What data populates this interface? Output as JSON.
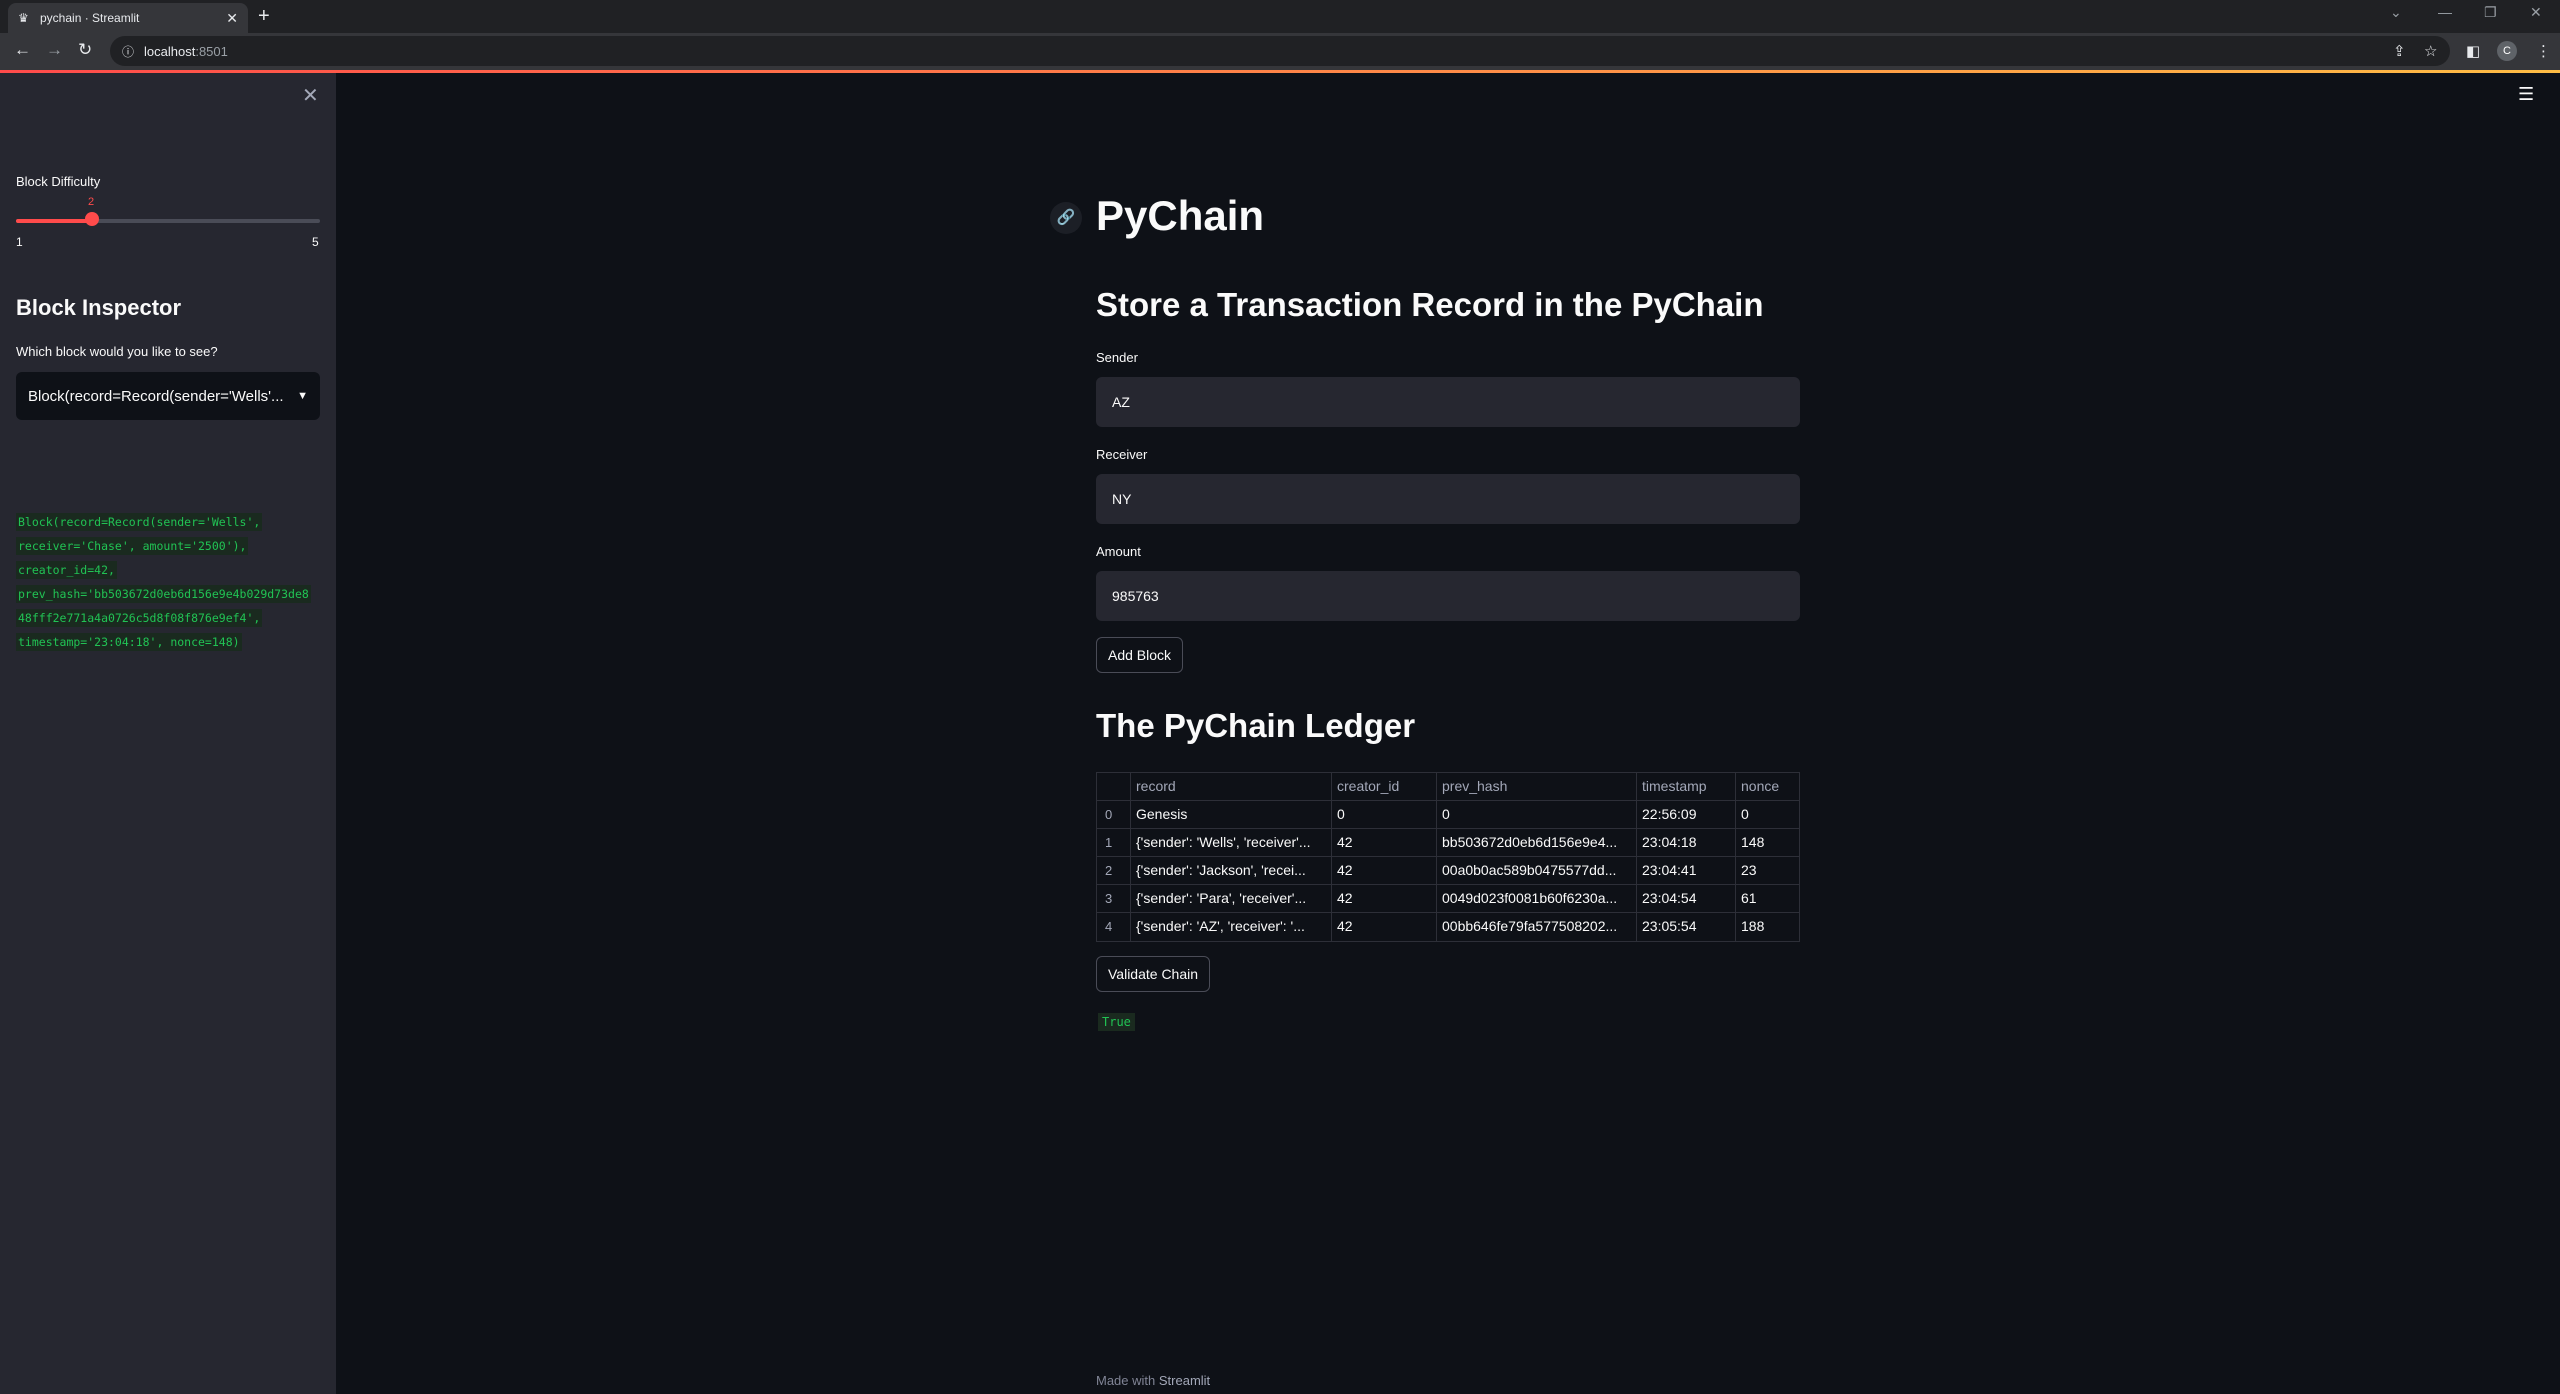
{
  "browser": {
    "tab_title": "pychain · Streamlit",
    "url_host": "localhost",
    "url_port": ":8501",
    "profile_initial": "C"
  },
  "sidebar": {
    "slider_label": "Block Difficulty",
    "slider_value": "2",
    "slider_min": "1",
    "slider_max": "5",
    "heading": "Block Inspector",
    "select_label": "Which block would you like to see?",
    "select_value": "Block(record=Record(sender='Wells'...",
    "block_detail_lines": [
      "Block(record=Record(sender='Wells',",
      "receiver='Chase', amount='2500'),",
      "creator_id=42,",
      "prev_hash='bb503672d0eb6d156e9e4b029d73de8",
      "48fff2e771a4a0726c5d8f08f876e9ef4',",
      "timestamp='23:04:18', nonce=148)"
    ]
  },
  "main": {
    "title": "PyChain",
    "form_heading": "Store a Transaction Record in the PyChain",
    "sender_label": "Sender",
    "sender_value": "AZ",
    "receiver_label": "Receiver",
    "receiver_value": "NY",
    "amount_label": "Amount",
    "amount_value": "985763",
    "add_block_label": "Add Block",
    "ledger_heading": "The PyChain Ledger",
    "validate_label": "Validate Chain",
    "validation_result": "True",
    "footer_prefix": "Made with",
    "footer_brand": "Streamlit"
  },
  "ledger": {
    "columns": [
      "",
      "record",
      "creator_id",
      "prev_hash",
      "timestamp",
      "nonce"
    ],
    "rows": [
      [
        "0",
        "Genesis",
        "0",
        "0",
        "22:56:09",
        "0"
      ],
      [
        "1",
        "{'sender': 'Wells', 'receiver'...",
        "42",
        "bb503672d0eb6d156e9e4...",
        "23:04:18",
        "148"
      ],
      [
        "2",
        "{'sender': 'Jackson', 'recei...",
        "42",
        "00a0b0ac589b0475577dd...",
        "23:04:41",
        "23"
      ],
      [
        "3",
        "{'sender': 'Para', 'receiver'...",
        "42",
        "0049d023f0081b60f6230a...",
        "23:04:54",
        "61"
      ],
      [
        "4",
        "{'sender': 'AZ', 'receiver': '...",
        "42",
        "00bb646fe79fa577508202...",
        "23:05:54",
        "188"
      ]
    ]
  },
  "colors": {
    "accent": "#ff4b4b",
    "background": "#0e1117",
    "sidebar": "#262730",
    "success_text": "#21c354"
  }
}
